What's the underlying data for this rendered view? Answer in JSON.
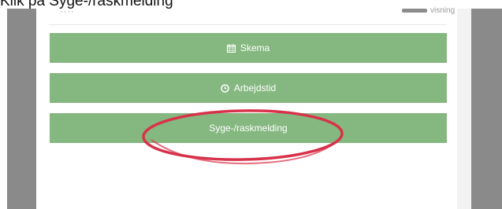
{
  "caption": "Klik på Syge-/raskmelding",
  "header": {
    "logo_text": "····",
    "right_text": "visning"
  },
  "menu": {
    "skema_label": "Skema",
    "arbejdstid_label": "Arbejdstid",
    "syge_label": "Syge-/raskmelding"
  },
  "icons": {
    "skema": "calendar-icon",
    "arbejdstid": "clock-icon"
  },
  "colors": {
    "button_green": "#85b880",
    "highlight_red": "#d8324a",
    "gutter_gray": "#8a8a8a"
  }
}
